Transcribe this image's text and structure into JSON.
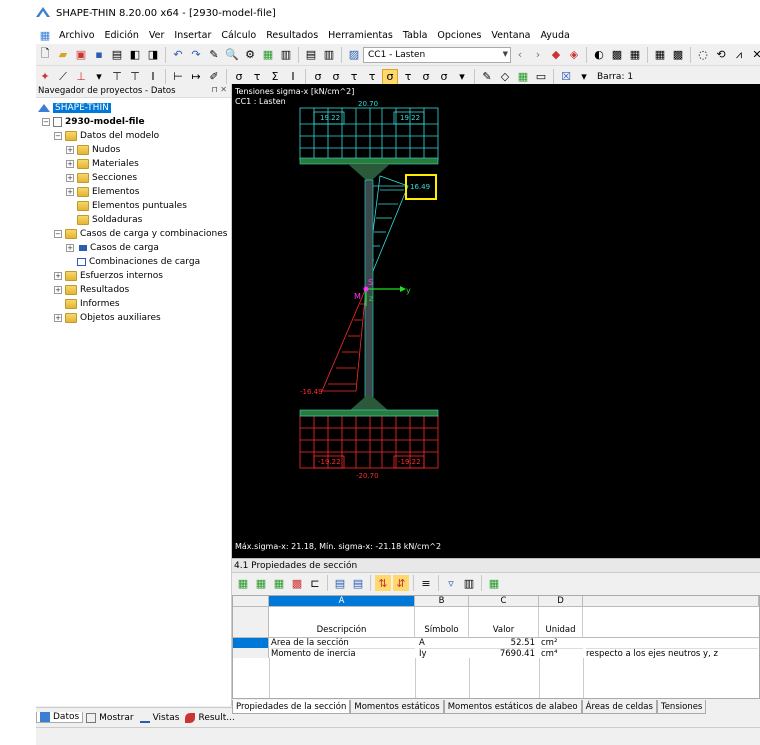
{
  "window": {
    "title": "SHAPE-THIN 8.20.00 x64 - [2930-model-file]"
  },
  "menu": [
    "Archivo",
    "Edición",
    "Ver",
    "Insertar",
    "Cálculo",
    "Resultados",
    "Herramientas",
    "Tabla",
    "Opciones",
    "Ventana",
    "Ayuda"
  ],
  "toolbar": {
    "loadcase": "CC1 - Lasten",
    "member": "Barra: 1"
  },
  "navigator": {
    "title": "Navegador de proyectos - Datos",
    "root": "SHAPE-THIN",
    "file": "2930-model-file",
    "items": {
      "datos": "Datos del modelo",
      "nudos": "Nudos",
      "materiales": "Materiales",
      "secciones": "Secciones",
      "elementos": "Elementos",
      "elementos_puntuales": "Elementos puntuales",
      "soldaduras": "Soldaduras",
      "casos": "Casos de carga y combinaciones",
      "casos_carga": "Casos de carga",
      "combinaciones": "Combinaciones de carga",
      "esfuerzos": "Esfuerzos internos",
      "resultados": "Resultados",
      "informes": "Informes",
      "objetos": "Objetos auxiliares"
    },
    "tabs": [
      "Datos",
      "Mostrar",
      "Vistas",
      "Result..."
    ]
  },
  "canvas": {
    "line1": "Tensiones sigma-x [kN/cm^2]",
    "line2": "CC1 : Lasten",
    "summary": "Máx.sigma-x: 21.18, Mín. sigma-x: -21.18 kN/cm^2",
    "labels": {
      "top": "20.70",
      "top_left_flange": "19.22",
      "top_right_flange": "19.22",
      "web_top": "16.49",
      "web_bottom": "-16.49",
      "bot_left_flange": "-19.22",
      "bot_right_flange": "-19.22",
      "bottom": "-20.70",
      "centroid_s": "S",
      "centroid_m": "M",
      "axis_y": "y",
      "axis_z": "z"
    },
    "colors": {
      "compression": "#ff2a2a",
      "tension": "#33dddd",
      "highlight": "#ffee00"
    }
  },
  "panel": {
    "title": "4.1 Propiedades de sección",
    "columns": {
      "a": "A",
      "b": "B",
      "c": "C",
      "d": "D"
    },
    "headers": {
      "desc": "Descripción",
      "sym": "Símbolo",
      "val": "Valor",
      "unit": "Unidad"
    },
    "rows": [
      {
        "desc": "Área de la sección",
        "sym": "A",
        "val": "52.51",
        "unit": "cm²",
        "note": ""
      },
      {
        "desc": "Momento de inercia",
        "sym": "Iy",
        "val": "7690.41",
        "unit": "cm⁴",
        "note": "respecto a los ejes neutros y, z"
      }
    ],
    "tabs": [
      "Propiedades de la sección",
      "Momentos estáticos",
      "Momentos estáticos de alabeo",
      "Áreas de celdas",
      "Tensiones"
    ]
  }
}
